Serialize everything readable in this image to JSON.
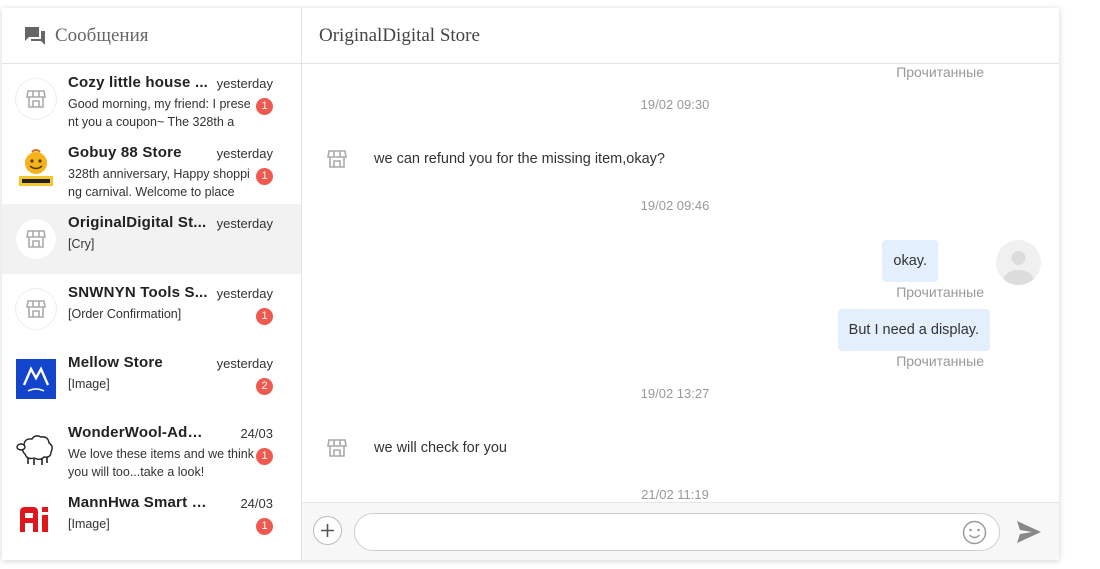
{
  "sidebar": {
    "title": "Сообщения",
    "conversations": [
      {
        "name": "Cozy little house ...",
        "time": "yesterday",
        "preview": "Good morning, my friend: I present you a coupon~ The 328th a",
        "badge": "1",
        "avatar": "store-icon"
      },
      {
        "name": "Gobuy 88 Store",
        "time": "yesterday",
        "preview": "328th anniversary, Happy shopping carnival. Welcome to place",
        "badge": "1",
        "avatar": "welcome-logo"
      },
      {
        "name": "OriginalDigital St...",
        "time": "yesterday",
        "preview": "[Cry]",
        "badge": "",
        "avatar": "store-icon"
      },
      {
        "name": "SNWNYN Tools S...",
        "time": "yesterday",
        "preview": "[Order Confirmation]",
        "badge": "1",
        "avatar": "store-icon"
      },
      {
        "name": "Mellow Store",
        "time": "yesterday",
        "preview": "[Image]",
        "badge": "2",
        "avatar": "mellow-logo"
      },
      {
        "name": "WonderWool-Adult ...",
        "time": "24/03",
        "preview": "We love these items and we think you will too...take a look!",
        "badge": "1",
        "avatar": "sheep-logo"
      },
      {
        "name": "MannHwa Smart Ho...",
        "time": "24/03",
        "preview": "[Image]",
        "badge": "1",
        "avatar": "ai-logo"
      }
    ]
  },
  "chat": {
    "title": "OriginalDigital Store",
    "read_label_top": "Прочитанные",
    "ts1": "19/02 09:30",
    "msg1": "we can refund you for the missing item,okay?",
    "ts2": "19/02 09:46",
    "out1": "okay.",
    "read1": "Прочитанные",
    "out2": "But I need a display.",
    "read2": "Прочитанные",
    "ts3": "19/02 13:27",
    "msg2": "we will check for you",
    "ts4": "21/02 11:19"
  },
  "composer": {
    "value": "",
    "placeholder": ""
  },
  "colors": {
    "badge": "#ee5a4f",
    "bubble_out": "#e3effd",
    "active_row": "#f2f2f2"
  }
}
